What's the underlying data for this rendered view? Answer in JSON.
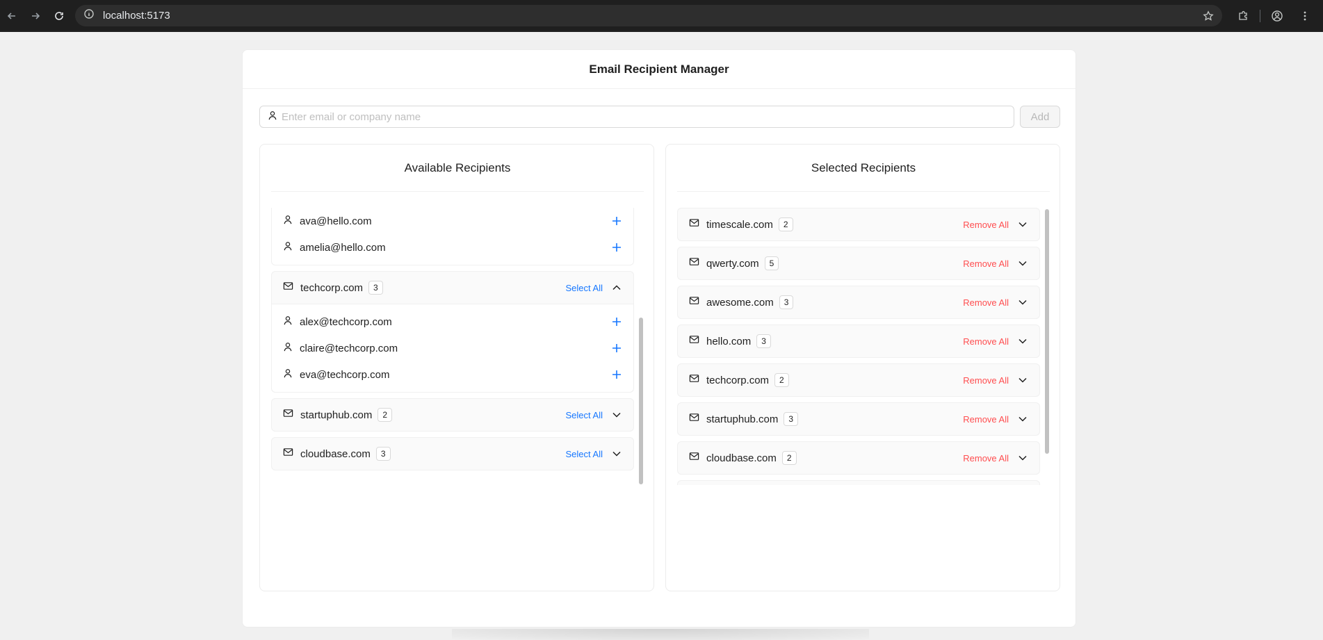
{
  "browser": {
    "url": "localhost:5173"
  },
  "app": {
    "title": "Email Recipient Manager",
    "search_placeholder": "Enter email or company name",
    "search_value": "",
    "add_label": "Add"
  },
  "available": {
    "title": "Available Recipients",
    "partial_members": [
      "ava@hello.com",
      "amelia@hello.com"
    ],
    "groups": [
      {
        "name": "techcorp.com",
        "count": "3",
        "action": "Select All",
        "expanded": true,
        "members": [
          "alex@techcorp.com",
          "claire@techcorp.com",
          "eva@techcorp.com"
        ]
      },
      {
        "name": "startuphub.com",
        "count": "2",
        "action": "Select All",
        "expanded": false
      },
      {
        "name": "cloudbase.com",
        "count": "3",
        "action": "Select All",
        "expanded": false
      }
    ]
  },
  "selected": {
    "title": "Selected Recipients",
    "groups": [
      {
        "name": "timescale.com",
        "count": "2",
        "action": "Remove All"
      },
      {
        "name": "qwerty.com",
        "count": "5",
        "action": "Remove All"
      },
      {
        "name": "awesome.com",
        "count": "3",
        "action": "Remove All"
      },
      {
        "name": "hello.com",
        "count": "3",
        "action": "Remove All"
      },
      {
        "name": "techcorp.com",
        "count": "2",
        "action": "Remove All"
      },
      {
        "name": "startuphub.com",
        "count": "3",
        "action": "Remove All"
      },
      {
        "name": "cloudbase.com",
        "count": "2",
        "action": "Remove All"
      }
    ]
  },
  "colors": {
    "accent": "#1677ff",
    "danger": "#ff4d4f",
    "background": "#f0f0f0"
  },
  "icons": [
    "user-icon",
    "mail-icon",
    "plus-icon",
    "chevron-down-icon",
    "chevron-up-icon"
  ]
}
